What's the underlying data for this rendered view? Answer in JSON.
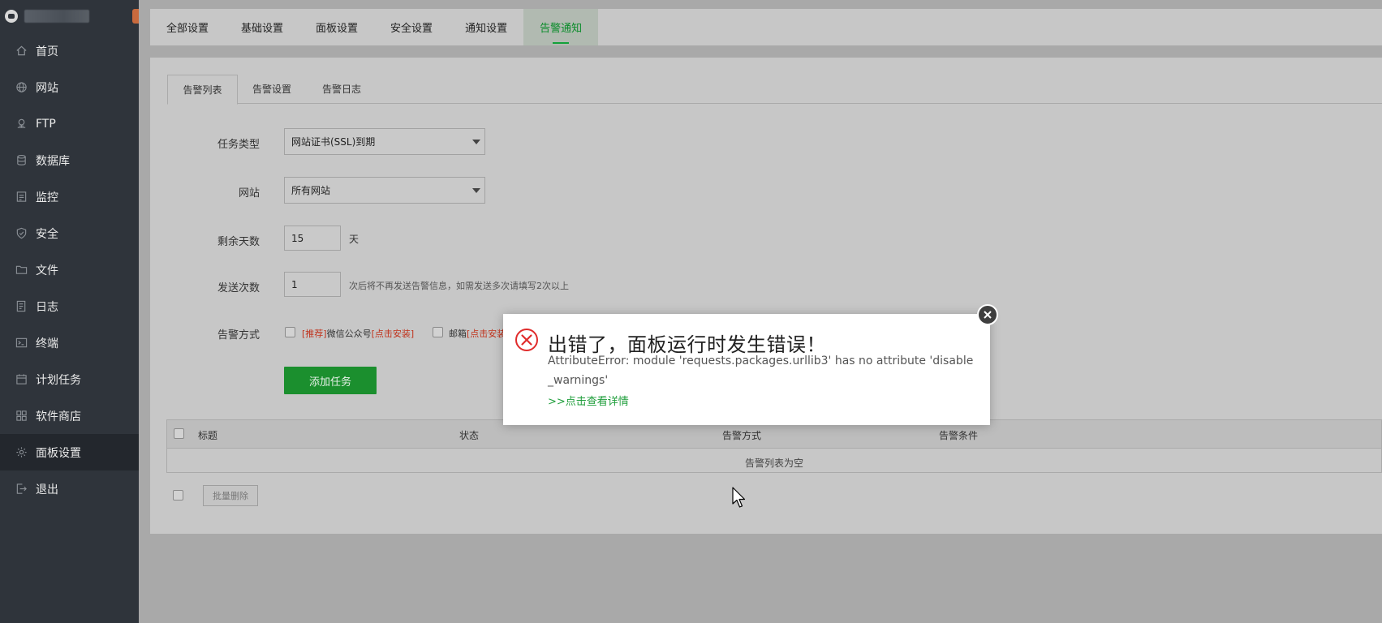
{
  "sidebar": {
    "items": [
      {
        "label": "首页",
        "icon": "home-icon",
        "name": "sidebar-item-home"
      },
      {
        "label": "网站",
        "icon": "globe-icon",
        "name": "sidebar-item-website"
      },
      {
        "label": "FTP",
        "icon": "ftp-icon",
        "name": "sidebar-item-ftp"
      },
      {
        "label": "数据库",
        "icon": "database-icon",
        "name": "sidebar-item-database"
      },
      {
        "label": "监控",
        "icon": "monitor-icon",
        "name": "sidebar-item-monitor"
      },
      {
        "label": "安全",
        "icon": "shield-icon",
        "name": "sidebar-item-security"
      },
      {
        "label": "文件",
        "icon": "folder-icon",
        "name": "sidebar-item-files"
      },
      {
        "label": "日志",
        "icon": "log-icon",
        "name": "sidebar-item-logs"
      },
      {
        "label": "终端",
        "icon": "terminal-icon",
        "name": "sidebar-item-terminal"
      },
      {
        "label": "计划任务",
        "icon": "calendar-icon",
        "name": "sidebar-item-cron"
      },
      {
        "label": "软件商店",
        "icon": "apps-icon",
        "name": "sidebar-item-store"
      },
      {
        "label": "面板设置",
        "icon": "gear-icon",
        "name": "sidebar-item-panel-settings",
        "active": true
      },
      {
        "label": "退出",
        "icon": "logout-icon",
        "name": "sidebar-item-logout"
      }
    ]
  },
  "tabs": [
    "全部设置",
    "基础设置",
    "面板设置",
    "安全设置",
    "通知设置",
    "告警通知"
  ],
  "active_tab": "告警通知",
  "subtabs": [
    "告警列表",
    "告警设置",
    "告警日志"
  ],
  "form": {
    "task_type_label": "任务类型",
    "task_type_value": "网站证书(SSL)到期",
    "site_label": "网站",
    "site_value": "所有网站",
    "days_label": "剩余天数",
    "days_value": "15",
    "days_unit": "天",
    "send_count_label": "发送次数",
    "send_count_value": "1",
    "send_count_hint": "次后将不再发送告警信息，如需发送多次请填写2次以上",
    "method_label": "告警方式",
    "method_wechat_tag": "[推荐]",
    "method_wechat": "微信公众号",
    "method_wechat_install": "[点击安装]",
    "method_email": "邮箱",
    "method_email_install": "[点击安装]",
    "add_button": "添加任务"
  },
  "table": {
    "columns": [
      "标题",
      "状态",
      "告警方式",
      "告警条件"
    ],
    "empty_text": "告警列表为空"
  },
  "batch_delete": "批量删除",
  "modal": {
    "title": "出错了，面板运行时发生错误！",
    "message": "AttributeError: module 'requests.packages.urllib3' has no attribute 'disable_warnings'",
    "link": ">>点击查看详情"
  },
  "colors": {
    "accent": "#1b8f2e",
    "sidebar_bg": "#2f343b",
    "error": "#e02b2b",
    "link": "#1f9e3b"
  }
}
